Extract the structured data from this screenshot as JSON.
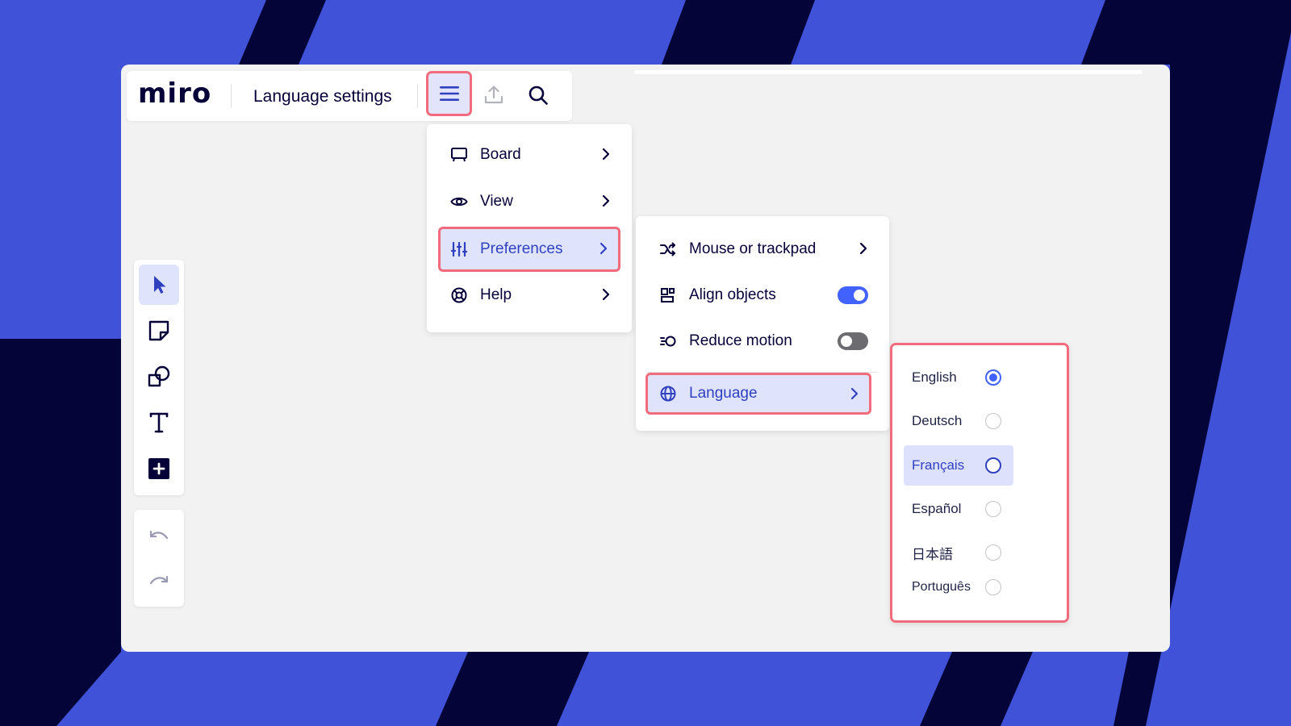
{
  "app": {
    "logo": "miro",
    "board_title": "Language settings"
  },
  "colors": {
    "background": "#4053d8",
    "stripe": "#050438",
    "accent": "#4262ff",
    "highlight_border": "#f26b7c",
    "highlight_fill": "#dfe3fb"
  },
  "toolbar": {
    "icons": [
      "hamburger-menu-icon",
      "upload-icon",
      "search-icon"
    ]
  },
  "main_menu": {
    "items": [
      {
        "label": "Board",
        "icon": "board-icon",
        "has_submenu": true
      },
      {
        "label": "View",
        "icon": "eye-icon",
        "has_submenu": true
      },
      {
        "label": "Preferences",
        "icon": "sliders-icon",
        "has_submenu": true,
        "highlighted": true
      },
      {
        "label": "Help",
        "icon": "lifebuoy-icon",
        "has_submenu": true
      }
    ]
  },
  "preferences_menu": {
    "items": [
      {
        "label": "Mouse or trackpad",
        "icon": "shuffle-icon",
        "has_submenu": true
      },
      {
        "label": "Align objects",
        "icon": "align-icon",
        "toggle": true,
        "on": true
      },
      {
        "label": "Reduce motion",
        "icon": "motion-icon",
        "toggle": true,
        "on": false
      },
      {
        "label": "Language",
        "icon": "globe-icon",
        "has_submenu": true,
        "highlighted": true
      }
    ]
  },
  "language_menu": {
    "options": [
      {
        "label": "English",
        "selected": true
      },
      {
        "label": "Deutsch",
        "selected": false
      },
      {
        "label": "Français",
        "selected": false,
        "hovered": true
      },
      {
        "label": "Español",
        "selected": false
      },
      {
        "label": "日本語",
        "selected": false
      },
      {
        "label": "Português",
        "selected": false
      }
    ]
  },
  "left_toolbar": {
    "tools": [
      "select-cursor-icon",
      "sticky-note-icon",
      "shapes-icon",
      "text-icon",
      "add-more-icon"
    ],
    "history": [
      "undo-icon",
      "redo-icon"
    ]
  }
}
